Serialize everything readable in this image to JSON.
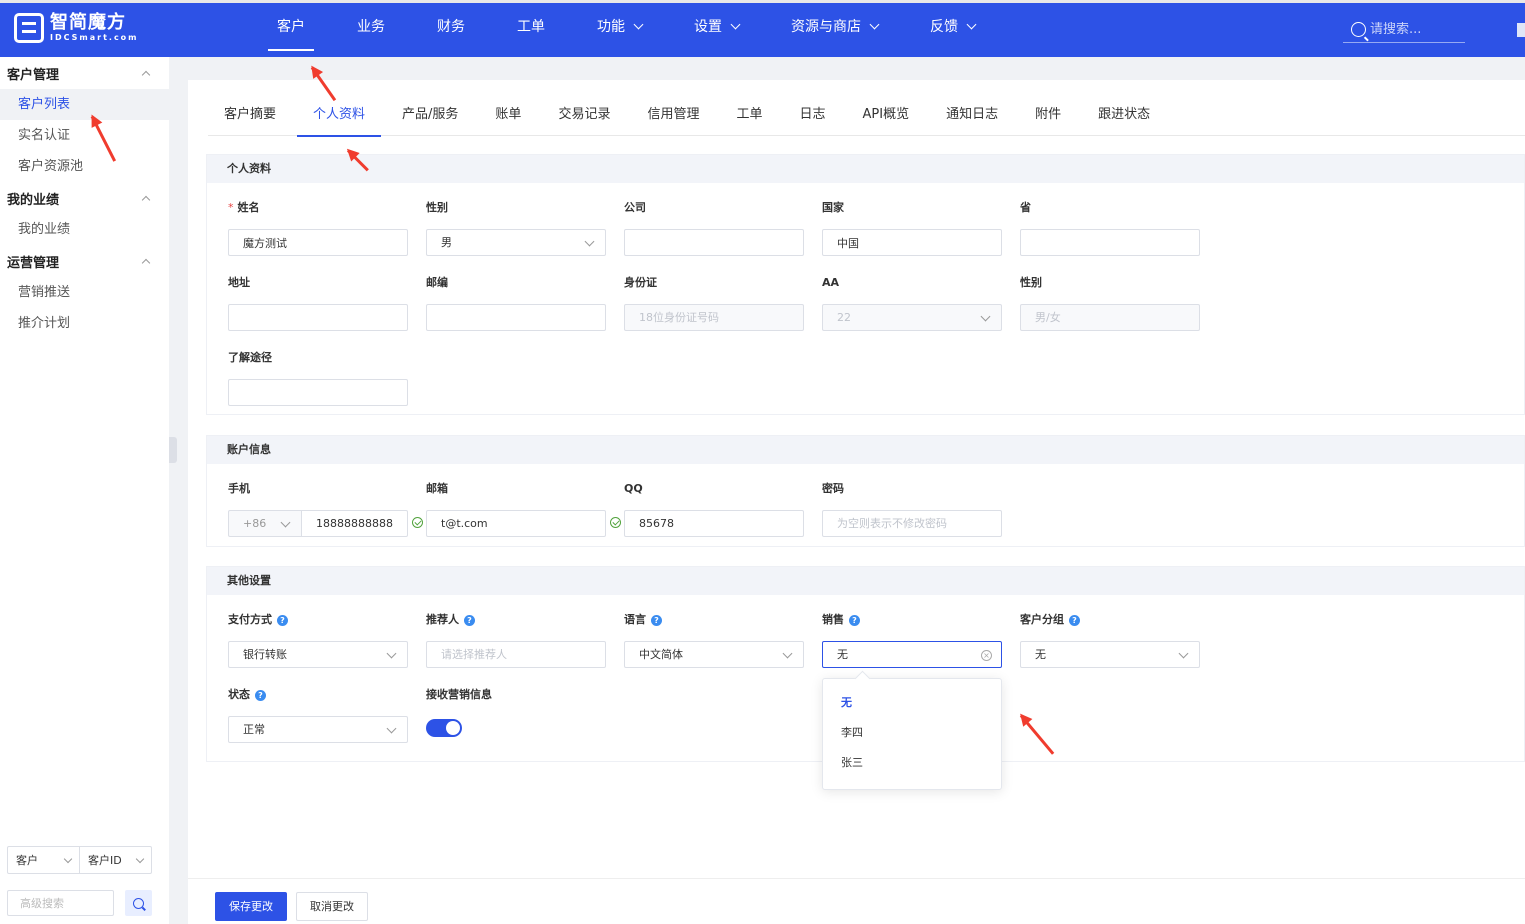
{
  "logo": {
    "cn": "智简魔方",
    "en": "IDCSmart.com"
  },
  "topnav": [
    {
      "label": "客户",
      "active": true,
      "dropdown": false
    },
    {
      "label": "业务",
      "active": false,
      "dropdown": false
    },
    {
      "label": "财务",
      "active": false,
      "dropdown": false
    },
    {
      "label": "工单",
      "active": false,
      "dropdown": false
    },
    {
      "label": "功能",
      "active": false,
      "dropdown": true
    },
    {
      "label": "设置",
      "active": false,
      "dropdown": true
    },
    {
      "label": "资源与商店",
      "active": false,
      "dropdown": true
    },
    {
      "label": "反馈",
      "active": false,
      "dropdown": true
    }
  ],
  "search": {
    "placeholder": "请搜索..."
  },
  "sidebar": {
    "groups": [
      {
        "label": "客户管理",
        "items": [
          {
            "label": "客户列表",
            "active": true
          },
          {
            "label": "实名认证",
            "active": false
          },
          {
            "label": "客户资源池",
            "active": false
          }
        ]
      },
      {
        "label": "我的业绩",
        "items": [
          {
            "label": "我的业绩",
            "active": false
          }
        ]
      },
      {
        "label": "运营管理",
        "items": [
          {
            "label": "营销推送",
            "active": false
          },
          {
            "label": "推介计划",
            "active": false
          }
        ]
      }
    ],
    "bottom": {
      "type_select": "客户",
      "field_select": "客户ID",
      "adv_placeholder": "高级搜索"
    }
  },
  "tabs": [
    {
      "label": "客户摘要",
      "active": false
    },
    {
      "label": "个人资料",
      "active": true
    },
    {
      "label": "产品/服务",
      "active": false
    },
    {
      "label": "账单",
      "active": false
    },
    {
      "label": "交易记录",
      "active": false
    },
    {
      "label": "信用管理",
      "active": false
    },
    {
      "label": "工单",
      "active": false
    },
    {
      "label": "日志",
      "active": false
    },
    {
      "label": "API概览",
      "active": false
    },
    {
      "label": "通知日志",
      "active": false
    },
    {
      "label": "附件",
      "active": false
    },
    {
      "label": "跟进状态",
      "active": false
    }
  ],
  "personal": {
    "title": "个人资料",
    "name": {
      "label": "姓名",
      "required_mark": "*",
      "value": "魔方测试"
    },
    "gender": {
      "label": "性别",
      "value": "男"
    },
    "company": {
      "label": "公司",
      "value": ""
    },
    "country": {
      "label": "国家",
      "value": "中国"
    },
    "province": {
      "label": "省",
      "value": ""
    },
    "address": {
      "label": "地址",
      "value": ""
    },
    "postcode": {
      "label": "邮编",
      "value": ""
    },
    "idcard": {
      "label": "身份证",
      "placeholder": "18位身份证号码"
    },
    "aa": {
      "label": "AA",
      "value": "22"
    },
    "gender2": {
      "label": "性别",
      "placeholder": "男/女"
    },
    "source": {
      "label": "了解途径",
      "value": ""
    }
  },
  "account": {
    "title": "账户信息",
    "phone": {
      "label": "手机",
      "code": "+86",
      "value": "18888888888"
    },
    "email": {
      "label": "邮箱",
      "value": "t@t.com"
    },
    "qq": {
      "label": "QQ",
      "value": "85678"
    },
    "password": {
      "label": "密码",
      "placeholder": "为空则表示不修改密码"
    }
  },
  "other": {
    "title": "其他设置",
    "payment": {
      "label": "支付方式",
      "value": "银行转账"
    },
    "referrer": {
      "label": "推荐人",
      "placeholder": "请选择推荐人"
    },
    "language": {
      "label": "语言",
      "value": "中文简体"
    },
    "sales": {
      "label": "销售",
      "value": "无",
      "options": [
        "无",
        "李四",
        "张三"
      ]
    },
    "group": {
      "label": "客户分组",
      "value": "无"
    },
    "status": {
      "label": "状态",
      "value": "正常"
    },
    "marketing": {
      "label": "接收营销信息",
      "enabled": true
    }
  },
  "footer": {
    "save": "保存更改",
    "cancel": "取消更改"
  },
  "colors": {
    "brand": "#2d52e6",
    "annotation": "#f03c2e"
  }
}
